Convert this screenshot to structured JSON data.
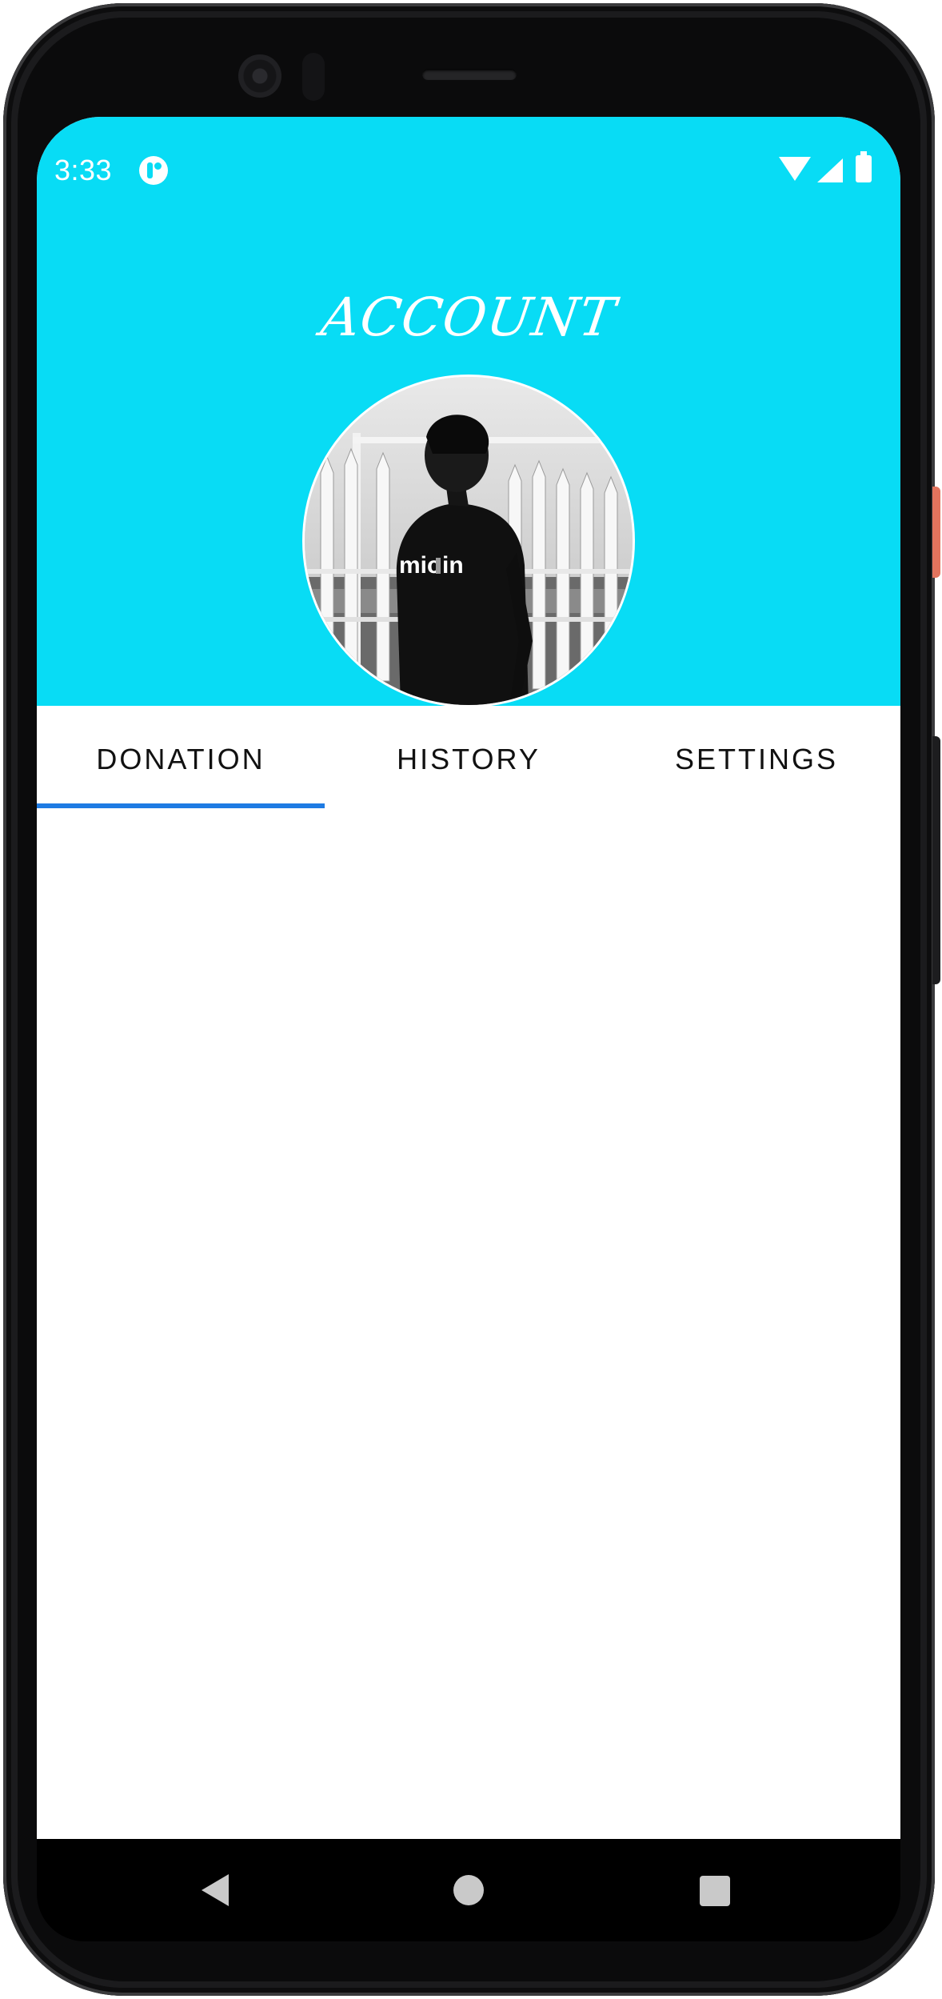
{
  "status_bar": {
    "time": "3:33",
    "icons": [
      "app-notification-icon",
      "wifi-icon",
      "signal-icon",
      "battery-icon"
    ]
  },
  "header": {
    "title": "ACCOUNT",
    "background_color": "#08dcf5",
    "avatar": "profile-photo"
  },
  "tabs": [
    {
      "label": "DONATION",
      "selected": true
    },
    {
      "label": "HISTORY",
      "selected": false
    },
    {
      "label": "SETTINGS",
      "selected": false
    }
  ],
  "colors": {
    "accent": "#1e7be3",
    "header": "#08dcf5"
  },
  "nav_bar": {
    "icons": [
      "back-icon",
      "home-icon",
      "recents-icon"
    ]
  }
}
